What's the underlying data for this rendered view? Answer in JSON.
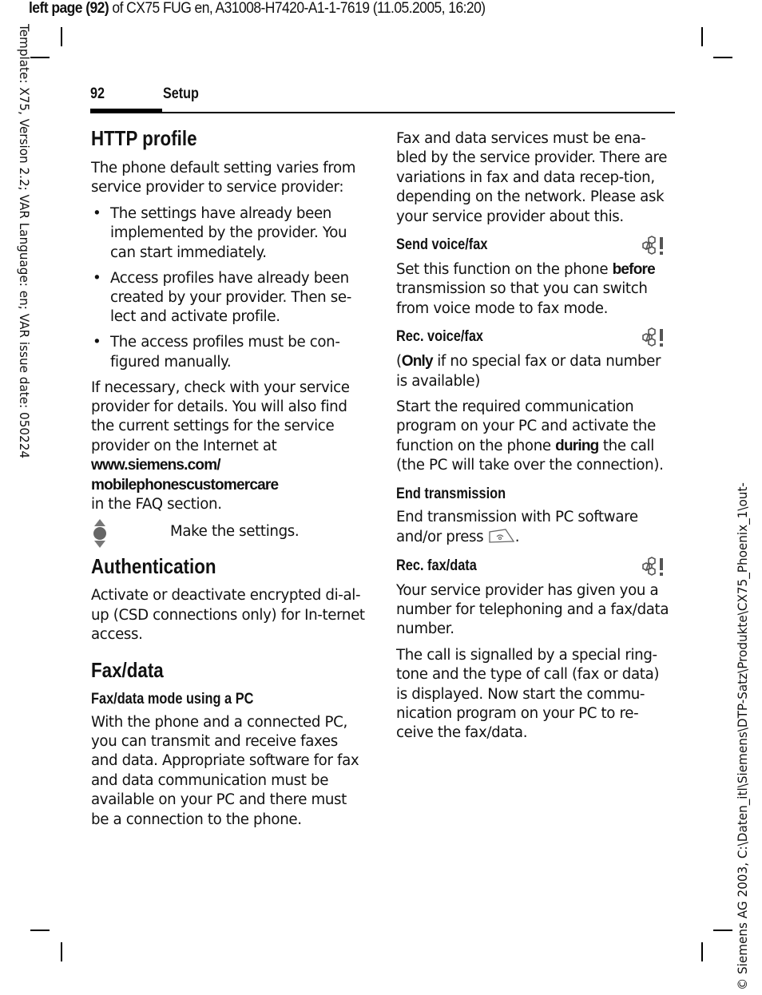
{
  "meta": {
    "top_line_bold": "left page (92)",
    "top_line_rest": " of CX75 FUG en, A31008-H7420-A1-1-7619 (11.05.2005, 16:20)",
    "left_margin_text": "Template: X75, Version 2.2; VAR Language: en; VAR issue date: 050224",
    "right_margin_text": "© Siemens AG 2003, C:\\Daten_itl\\Siemens\\DTP-Satz\\Produkte\\CX75_Phoenix_1\\out-"
  },
  "header": {
    "page_number": "92",
    "section": "Setup"
  },
  "left_column": {
    "http_profile": {
      "title": "HTTP profile",
      "intro": "The phone default setting varies from service provider to service provider:",
      "bullets": [
        "The settings have already been implemented by the provider. You can start immediately.",
        "Access profiles have already been created by your provider. Then se-lect and activate profile.",
        "The access profiles must be con-figured manually."
      ],
      "check_text": "If necessary, check with your service provider for details. You will also find the current settings for the service provider on the Internet at",
      "url_line1": "www.siemens.com/",
      "url_line2": "mobilephonescustomercare",
      "after_url": "in the FAQ section.",
      "nav_icon": "navigation-key-icon",
      "nav_instruction": "Make the settings."
    },
    "authentication": {
      "title": "Authentication",
      "text": "Activate or deactivate encrypted di-al-up (CSD connections only) for In-ternet access."
    },
    "fax_data": {
      "title": "Fax/data",
      "subtitle": "Fax/data mode using a PC",
      "text": "With the phone and a connected PC, you can transmit and receive faxes and data. Appropriate software for fax and data communication must be available on your PC and there must be a connection to the phone."
    }
  },
  "right_column": {
    "intro": "Fax and data services must be ena-bled by the service provider. There are variations in fax and data recep-tion, depending on the network. Please ask your service provider about this.",
    "send_voice_fax": {
      "title": "Send voice/fax",
      "badge_icon": "network-dependent-icon",
      "text_before": "Set this function on the phone ",
      "text_bold": "before",
      "text_after": " transmission so that you can switch from voice mode to fax mode."
    },
    "rec_voice_fax": {
      "title": "Rec. voice/fax",
      "badge_icon": "network-dependent-icon",
      "note_open": "(",
      "note_bold": "Only",
      "note_rest": " if no special fax or data number is available)",
      "text_before": "Start the required communication program on your PC and activate the function on the phone ",
      "text_bold": "during",
      "text_after": " the call (the PC will take over the connection)."
    },
    "end_transmission": {
      "title": "End transmission",
      "text_before": "End transmission with PC software and/or press ",
      "key_icon": "end-call-key-icon",
      "text_after": "."
    },
    "rec_fax_data": {
      "title": "Rec. fax/data",
      "badge_icon": "network-dependent-icon",
      "text1": "Your service provider has given you a number for telephoning and a fax/data number.",
      "text2": "The call is signalled by a special ring-tone and the type of call (fax or data) is displayed. Now start the commu-nication program on your PC to re-ceive the fax/data."
    }
  }
}
